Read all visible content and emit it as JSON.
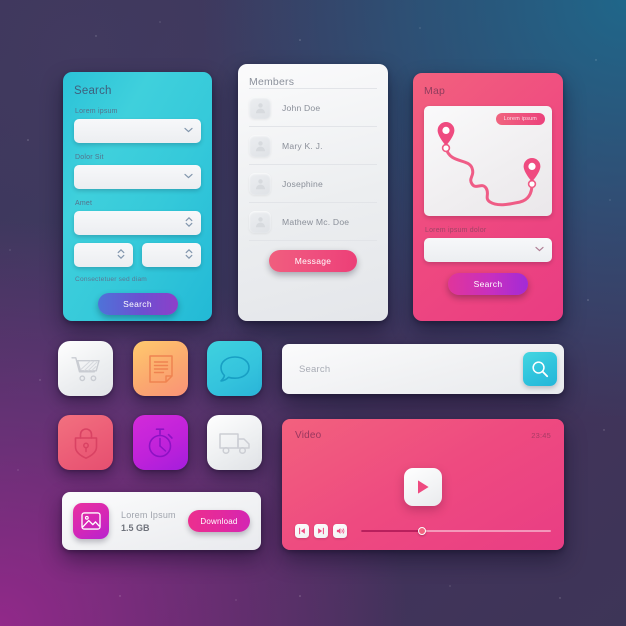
{
  "background": {
    "top_left_color": "#3c3558",
    "top_right_color": "#1e698c",
    "bottom_left_color": "#962a8c",
    "bottom_right_color": "#3d3557"
  },
  "search_card": {
    "title": "Search",
    "fields": [
      {
        "label": "Lorem ipsum",
        "control": "chevron-down-icon",
        "value": ""
      },
      {
        "label": "Dolor Sit",
        "control": "chevron-down-icon",
        "value": ""
      },
      {
        "label": "Amet",
        "control": "stepper-icon",
        "value": ""
      }
    ],
    "small_fields": [
      {
        "control": "stepper-icon",
        "value": ""
      },
      {
        "control": "stepper-icon",
        "value": ""
      }
    ],
    "hint": "Consectetuer sed diam",
    "submit_label": "Search",
    "accent": "#35c9da",
    "button_gradient": [
      "#4e73d8",
      "#8e3fc9"
    ]
  },
  "members_card": {
    "title": "Members",
    "members": [
      {
        "name": "John Doe",
        "avatar": "avatar-icon"
      },
      {
        "name": "Mary K. J.",
        "avatar": "avatar-icon"
      },
      {
        "name": "Josephine",
        "avatar": "avatar-icon"
      },
      {
        "name": "Mathew Mc. Doe",
        "avatar": "avatar-icon"
      }
    ],
    "button_label": "Message",
    "button_color": "#ee4a7e"
  },
  "map_card": {
    "title": "Map",
    "badge_label": "Lorem ipsum",
    "field_label": "Lorem ipsum dolor",
    "field_value": "",
    "field_control": "chevron-down-icon",
    "submit_label": "Search",
    "accent": "#ee4b80",
    "button_gradient": [
      "#e0359b",
      "#a22bd6"
    ],
    "markers": [
      "map-pin-start",
      "map-pin-end"
    ]
  },
  "tiles": [
    {
      "name": "shopping-cart",
      "icon": "cart-icon",
      "stroke": "#c9ccd2"
    },
    {
      "name": "document",
      "icon": "document-icon",
      "stroke": "#f0804f"
    },
    {
      "name": "chat",
      "icon": "chat-bubble-icon",
      "stroke": "#189fc4"
    },
    {
      "name": "security",
      "icon": "shield-lock-icon",
      "stroke": "#d94263"
    },
    {
      "name": "timer",
      "icon": "stopwatch-icon",
      "stroke": "#8d12c4"
    },
    {
      "name": "shipping",
      "icon": "truck-icon",
      "stroke": "#ccced4"
    }
  ],
  "search_bar": {
    "placeholder": "Search",
    "value": "",
    "button_icon": "search-icon",
    "button_color": "#2fc3dd"
  },
  "download_card": {
    "thumb_icon": "image-icon",
    "title": "Lorem Ipsum",
    "size": "1.5 GB",
    "button_label": "Download",
    "button_gradient": [
      "#ec2f8e",
      "#d325b4"
    ]
  },
  "video_card": {
    "title": "Video",
    "timestamp": "23:45",
    "play_icon": "play-icon",
    "controls": [
      {
        "name": "previous",
        "icon": "skip-back-icon"
      },
      {
        "name": "next",
        "icon": "skip-forward-icon"
      },
      {
        "name": "volume",
        "icon": "volume-icon"
      }
    ],
    "progress_percent": 32,
    "accent": "#ee4a80"
  }
}
